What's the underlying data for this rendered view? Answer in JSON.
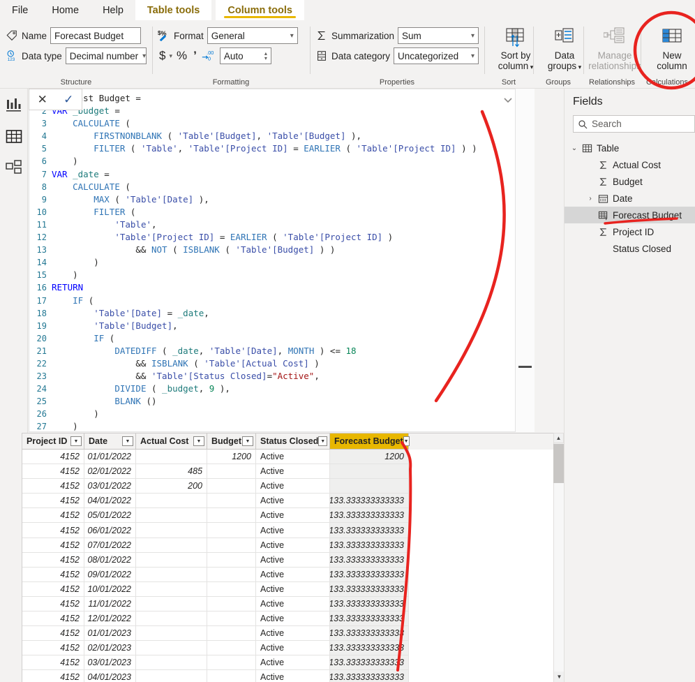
{
  "ribbon": {
    "tabs": [
      {
        "id": "file",
        "label": "File",
        "type": "normal"
      },
      {
        "id": "home",
        "label": "Home",
        "type": "normal"
      },
      {
        "id": "help",
        "label": "Help",
        "type": "normal"
      },
      {
        "id": "table-tools",
        "label": "Table tools",
        "type": "group"
      },
      {
        "id": "column-tools",
        "label": "Column tools",
        "type": "group-active"
      }
    ],
    "groups": {
      "structure": {
        "label": "Structure",
        "name_label": "Name",
        "name_value": "Forecast Budget",
        "datatype_label": "Data type",
        "datatype_value": "Decimal number"
      },
      "formatting": {
        "label": "Formatting",
        "format_label": "Format",
        "format_value": "General",
        "currency_icon": "$",
        "percent_icon": "%",
        "thousands_icon": " ,",
        "decimals_icon": ".00",
        "decimals_value": "Auto"
      },
      "properties": {
        "label": "Properties",
        "summarization_label": "Summarization",
        "summarization_value": "Sum",
        "datacategory_label": "Data category",
        "datacategory_value": "Uncategorized"
      },
      "sort": {
        "label": "Sort",
        "button": "Sort by\ncolumn",
        "line1": "Sort by",
        "line2": "column"
      },
      "groups": {
        "label": "Groups",
        "line1": "Data",
        "line2": "groups"
      },
      "relationships": {
        "label": "Relationships",
        "line1": "Manage",
        "line2": "relationships"
      },
      "calculations": {
        "label": "Calculations",
        "line1": "New",
        "line2": "column"
      }
    }
  },
  "rail": {
    "items": [
      {
        "id": "report-view",
        "name": "report-view-icon"
      },
      {
        "id": "data-view",
        "name": "data-view-icon"
      },
      {
        "id": "model-view",
        "name": "model-view-icon"
      }
    ]
  },
  "formula": {
    "cancel_icon": "✕",
    "commit_icon": "✓",
    "expand_icon": "⌄",
    "lines": [
      {
        "n": "1",
        "spans": [
          {
            "t": "Forecast Budget =",
            "c": "op"
          }
        ]
      },
      {
        "n": "2",
        "spans": [
          {
            "t": "VAR ",
            "c": "kw"
          },
          {
            "t": "_budget",
            "c": "var"
          },
          {
            "t": " =",
            "c": "op"
          }
        ]
      },
      {
        "n": "3",
        "spans": [
          {
            "t": "    ",
            "c": "op"
          },
          {
            "t": "CALCULATE",
            "c": "fn"
          },
          {
            "t": " (",
            "c": "op"
          }
        ]
      },
      {
        "n": "4",
        "spans": [
          {
            "t": "        ",
            "c": "op"
          },
          {
            "t": "FIRSTNONBLANK",
            "c": "fn"
          },
          {
            "t": " ( ",
            "c": "op"
          },
          {
            "t": "'Table'[Budget]",
            "c": "col"
          },
          {
            "t": ", ",
            "c": "op"
          },
          {
            "t": "'Table'[Budget]",
            "c": "col"
          },
          {
            "t": " ),",
            "c": "op"
          }
        ]
      },
      {
        "n": "5",
        "spans": [
          {
            "t": "        ",
            "c": "op"
          },
          {
            "t": "FILTER",
            "c": "fn"
          },
          {
            "t": " ( ",
            "c": "op"
          },
          {
            "t": "'Table'",
            "c": "col"
          },
          {
            "t": ", ",
            "c": "op"
          },
          {
            "t": "'Table'[Project ID]",
            "c": "col"
          },
          {
            "t": " = ",
            "c": "op"
          },
          {
            "t": "EARLIER",
            "c": "fn"
          },
          {
            "t": " ( ",
            "c": "op"
          },
          {
            "t": "'Table'[Project ID]",
            "c": "col"
          },
          {
            "t": " ) )",
            "c": "op"
          }
        ]
      },
      {
        "n": "6",
        "spans": [
          {
            "t": "    )",
            "c": "op"
          }
        ]
      },
      {
        "n": "7",
        "spans": [
          {
            "t": "VAR ",
            "c": "kw"
          },
          {
            "t": "_date",
            "c": "var"
          },
          {
            "t": " =",
            "c": "op"
          }
        ]
      },
      {
        "n": "8",
        "spans": [
          {
            "t": "    ",
            "c": "op"
          },
          {
            "t": "CALCULATE",
            "c": "fn"
          },
          {
            "t": " (",
            "c": "op"
          }
        ]
      },
      {
        "n": "9",
        "spans": [
          {
            "t": "        ",
            "c": "op"
          },
          {
            "t": "MAX",
            "c": "fn"
          },
          {
            "t": " ( ",
            "c": "op"
          },
          {
            "t": "'Table'[Date]",
            "c": "col"
          },
          {
            "t": " ),",
            "c": "op"
          }
        ]
      },
      {
        "n": "10",
        "spans": [
          {
            "t": "        ",
            "c": "op"
          },
          {
            "t": "FILTER",
            "c": "fn"
          },
          {
            "t": " (",
            "c": "op"
          }
        ]
      },
      {
        "n": "11",
        "spans": [
          {
            "t": "            ",
            "c": "op"
          },
          {
            "t": "'Table'",
            "c": "col"
          },
          {
            "t": ",",
            "c": "op"
          }
        ]
      },
      {
        "n": "12",
        "spans": [
          {
            "t": "            ",
            "c": "op"
          },
          {
            "t": "'Table'[Project ID]",
            "c": "col"
          },
          {
            "t": " = ",
            "c": "op"
          },
          {
            "t": "EARLIER",
            "c": "fn"
          },
          {
            "t": " ( ",
            "c": "op"
          },
          {
            "t": "'Table'[Project ID]",
            "c": "col"
          },
          {
            "t": " )",
            "c": "op"
          }
        ]
      },
      {
        "n": "13",
        "spans": [
          {
            "t": "                && ",
            "c": "op"
          },
          {
            "t": "NOT",
            "c": "fn"
          },
          {
            "t": " ( ",
            "c": "op"
          },
          {
            "t": "ISBLANK",
            "c": "fn"
          },
          {
            "t": " ( ",
            "c": "op"
          },
          {
            "t": "'Table'[Budget]",
            "c": "col"
          },
          {
            "t": " ) )",
            "c": "op"
          }
        ]
      },
      {
        "n": "14",
        "spans": [
          {
            "t": "        )",
            "c": "op"
          }
        ]
      },
      {
        "n": "15",
        "spans": [
          {
            "t": "    )",
            "c": "op"
          }
        ]
      },
      {
        "n": "16",
        "spans": [
          {
            "t": "RETURN",
            "c": "kw"
          }
        ]
      },
      {
        "n": "17",
        "spans": [
          {
            "t": "    ",
            "c": "op"
          },
          {
            "t": "IF",
            "c": "fn"
          },
          {
            "t": " (",
            "c": "op"
          }
        ]
      },
      {
        "n": "18",
        "spans": [
          {
            "t": "        ",
            "c": "op"
          },
          {
            "t": "'Table'[Date]",
            "c": "col"
          },
          {
            "t": " = ",
            "c": "op"
          },
          {
            "t": "_date",
            "c": "var"
          },
          {
            "t": ",",
            "c": "op"
          }
        ]
      },
      {
        "n": "19",
        "spans": [
          {
            "t": "        ",
            "c": "op"
          },
          {
            "t": "'Table'[Budget]",
            "c": "col"
          },
          {
            "t": ",",
            "c": "op"
          }
        ]
      },
      {
        "n": "20",
        "spans": [
          {
            "t": "        ",
            "c": "op"
          },
          {
            "t": "IF",
            "c": "fn"
          },
          {
            "t": " (",
            "c": "op"
          }
        ]
      },
      {
        "n": "21",
        "spans": [
          {
            "t": "            ",
            "c": "op"
          },
          {
            "t": "DATEDIFF",
            "c": "fn"
          },
          {
            "t": " ( ",
            "c": "op"
          },
          {
            "t": "_date",
            "c": "var"
          },
          {
            "t": ", ",
            "c": "op"
          },
          {
            "t": "'Table'[Date]",
            "c": "col"
          },
          {
            "t": ", ",
            "c": "op"
          },
          {
            "t": "MONTH",
            "c": "fn"
          },
          {
            "t": " ) <= ",
            "c": "op"
          },
          {
            "t": "18",
            "c": "num"
          }
        ]
      },
      {
        "n": "22",
        "spans": [
          {
            "t": "                && ",
            "c": "op"
          },
          {
            "t": "ISBLANK",
            "c": "fn"
          },
          {
            "t": " ( ",
            "c": "op"
          },
          {
            "t": "'Table'[Actual Cost]",
            "c": "col"
          },
          {
            "t": " )",
            "c": "op"
          }
        ]
      },
      {
        "n": "23",
        "spans": [
          {
            "t": "                && ",
            "c": "op"
          },
          {
            "t": "'Table'[Status Closed]",
            "c": "col"
          },
          {
            "t": "=",
            "c": "op"
          },
          {
            "t": "\"Active\"",
            "c": "str"
          },
          {
            "t": ",",
            "c": "op"
          }
        ]
      },
      {
        "n": "24",
        "spans": [
          {
            "t": "            ",
            "c": "op"
          },
          {
            "t": "DIVIDE",
            "c": "fn"
          },
          {
            "t": " ( ",
            "c": "op"
          },
          {
            "t": "_budget",
            "c": "var"
          },
          {
            "t": ", ",
            "c": "op"
          },
          {
            "t": "9",
            "c": "num"
          },
          {
            "t": " ),",
            "c": "op"
          }
        ]
      },
      {
        "n": "25",
        "spans": [
          {
            "t": "            ",
            "c": "op"
          },
          {
            "t": "BLANK",
            "c": "fn"
          },
          {
            "t": " ()",
            "c": "op"
          }
        ]
      },
      {
        "n": "26",
        "spans": [
          {
            "t": "        )",
            "c": "op"
          }
        ]
      },
      {
        "n": "27",
        "spans": [
          {
            "t": "    )",
            "c": "op"
          }
        ]
      }
    ]
  },
  "grid": {
    "columns": [
      {
        "key": "project_id",
        "label": "Project ID",
        "width": 89,
        "align": "r",
        "selected": false
      },
      {
        "key": "date",
        "label": "Date",
        "width": 74,
        "align": "r",
        "selected": false
      },
      {
        "key": "actual_cost",
        "label": "Actual Cost",
        "width": 102,
        "align": "r",
        "selected": false
      },
      {
        "key": "budget",
        "label": "Budget",
        "width": 70,
        "align": "r",
        "selected": false
      },
      {
        "key": "status_closed",
        "label": "Status Closed",
        "width": 106,
        "align": "l",
        "selected": false
      },
      {
        "key": "forecast_budget",
        "label": "Forecast Budget",
        "width": 113,
        "align": "r",
        "selected": true
      }
    ],
    "rows": [
      {
        "project_id": "4152",
        "date": "01/01/2022",
        "actual_cost": "",
        "budget": "1200",
        "status_closed": "Active",
        "forecast_budget": "1200"
      },
      {
        "project_id": "4152",
        "date": "02/01/2022",
        "actual_cost": "485",
        "budget": "",
        "status_closed": "Active",
        "forecast_budget": ""
      },
      {
        "project_id": "4152",
        "date": "03/01/2022",
        "actual_cost": "200",
        "budget": "",
        "status_closed": "Active",
        "forecast_budget": ""
      },
      {
        "project_id": "4152",
        "date": "04/01/2022",
        "actual_cost": "",
        "budget": "",
        "status_closed": "Active",
        "forecast_budget": "133.333333333333"
      },
      {
        "project_id": "4152",
        "date": "05/01/2022",
        "actual_cost": "",
        "budget": "",
        "status_closed": "Active",
        "forecast_budget": "133.333333333333"
      },
      {
        "project_id": "4152",
        "date": "06/01/2022",
        "actual_cost": "",
        "budget": "",
        "status_closed": "Active",
        "forecast_budget": "133.333333333333"
      },
      {
        "project_id": "4152",
        "date": "07/01/2022",
        "actual_cost": "",
        "budget": "",
        "status_closed": "Active",
        "forecast_budget": "133.333333333333"
      },
      {
        "project_id": "4152",
        "date": "08/01/2022",
        "actual_cost": "",
        "budget": "",
        "status_closed": "Active",
        "forecast_budget": "133.333333333333"
      },
      {
        "project_id": "4152",
        "date": "09/01/2022",
        "actual_cost": "",
        "budget": "",
        "status_closed": "Active",
        "forecast_budget": "133.333333333333"
      },
      {
        "project_id": "4152",
        "date": "10/01/2022",
        "actual_cost": "",
        "budget": "",
        "status_closed": "Active",
        "forecast_budget": "133.333333333333"
      },
      {
        "project_id": "4152",
        "date": "11/01/2022",
        "actual_cost": "",
        "budget": "",
        "status_closed": "Active",
        "forecast_budget": "133.333333333333"
      },
      {
        "project_id": "4152",
        "date": "12/01/2022",
        "actual_cost": "",
        "budget": "",
        "status_closed": "Active",
        "forecast_budget": "133.333333333333"
      },
      {
        "project_id": "4152",
        "date": "01/01/2023",
        "actual_cost": "",
        "budget": "",
        "status_closed": "Active",
        "forecast_budget": "133.333333333333"
      },
      {
        "project_id": "4152",
        "date": "02/01/2023",
        "actual_cost": "",
        "budget": "",
        "status_closed": "Active",
        "forecast_budget": "133.333333333333"
      },
      {
        "project_id": "4152",
        "date": "03/01/2023",
        "actual_cost": "",
        "budget": "",
        "status_closed": "Active",
        "forecast_budget": "133.333333333333"
      },
      {
        "project_id": "4152",
        "date": "04/01/2023",
        "actual_cost": "",
        "budget": "",
        "status_closed": "Active",
        "forecast_budget": "133.333333333333"
      }
    ]
  },
  "fields": {
    "title": "Fields",
    "search_placeholder": "Search",
    "tree": [
      {
        "id": "table",
        "label": "Table",
        "level": 0,
        "chev": "⌄",
        "icon": "table-icon",
        "selected": false
      },
      {
        "id": "actual-cost",
        "label": "Actual Cost",
        "level": 1,
        "chev": "",
        "icon": "sigma-icon",
        "selected": false
      },
      {
        "id": "budget",
        "label": "Budget",
        "level": 1,
        "chev": "",
        "icon": "sigma-icon",
        "selected": false
      },
      {
        "id": "date",
        "label": "Date",
        "level": 1,
        "chev": "›",
        "icon": "calendar-icon",
        "selected": false
      },
      {
        "id": "forecast-budget",
        "label": "Forecast Budget",
        "level": 1,
        "chev": "",
        "icon": "calc-column-icon",
        "selected": true
      },
      {
        "id": "project-id",
        "label": "Project ID",
        "level": 1,
        "chev": "",
        "icon": "sigma-icon",
        "selected": false
      },
      {
        "id": "status-closed",
        "label": "Status Closed",
        "level": 1,
        "chev": "",
        "icon": "none",
        "selected": false
      }
    ]
  },
  "colors": {
    "accent_yellow": "#e8b700",
    "tab_text_gold": "#8a6d0b",
    "annotation_red": "#e8231f",
    "ribbon_bg": "#f3f2f1",
    "selection_gray": "#d6d6d6"
  }
}
